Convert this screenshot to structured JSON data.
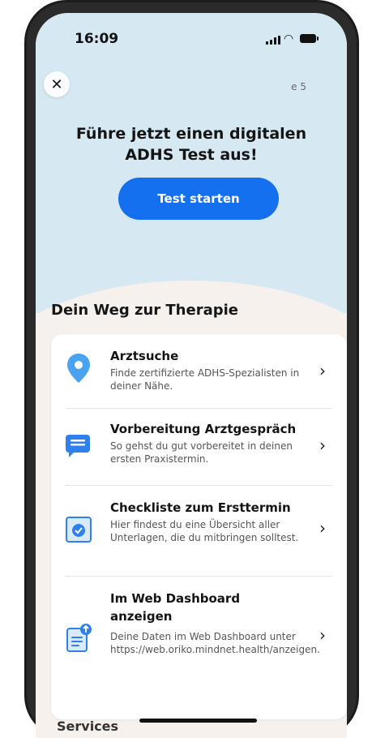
{
  "status": {
    "time": "16:09"
  },
  "header": {
    "page_counter": "e 5"
  },
  "hero": {
    "title": "Führe jetzt einen digitalen ADHS Test aus!",
    "cta_label": "Test starten"
  },
  "section": {
    "title": "Dein Weg zur Therapie"
  },
  "items": [
    {
      "title": "Arztsuche",
      "desc": "Finde zertifizierte ADHS-Spezialisten in deiner Nähe.",
      "icon": "location-pin-icon"
    },
    {
      "title": "Vorbereitung Arztgespräch",
      "desc": "So gehst du gut vorbereitet in deinen ersten Praxistermin.",
      "icon": "chat-bubble-icon"
    },
    {
      "title": "Checkliste zum Ersttermin",
      "desc": "Hier findest du eine Übersicht aller Unterlagen, die du mitbringen solltest.",
      "icon": "checklist-icon"
    },
    {
      "title": "Im Web Dashboard anzeigen",
      "desc": "Deine Daten im Web Dashboard unter https://web.oriko.mindnet.health/anzeigen.",
      "icon": "web-document-icon"
    }
  ],
  "footer": {
    "cut_text": "Services"
  },
  "colors": {
    "accent": "#1570EF",
    "hero_bg": "#D6E9F3",
    "page_bg": "#F7F1EE"
  }
}
